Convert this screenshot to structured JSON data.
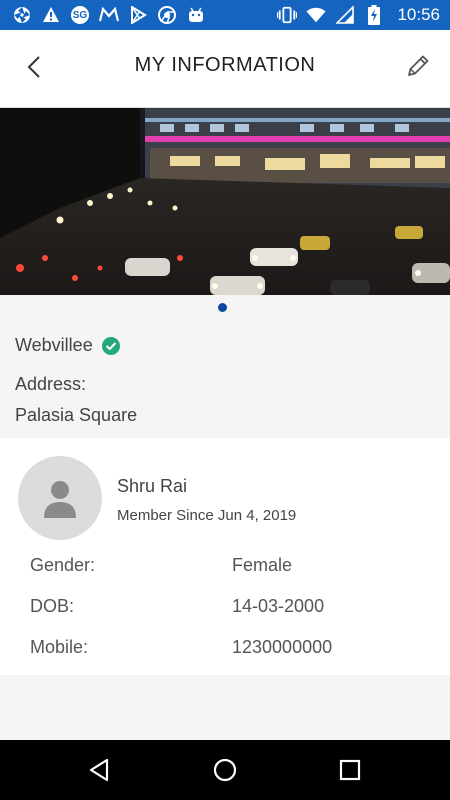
{
  "status_bar": {
    "time": "10:56",
    "left_icons": [
      "aperture-icon",
      "warning-icon",
      "sg-icon",
      "mail-icon",
      "play-store-icon",
      "chrome-icon",
      "android-icon"
    ],
    "sg_text": "SG",
    "right_icons": [
      "vibrate-icon",
      "wifi-icon",
      "signal-icon",
      "battery-charging-icon"
    ]
  },
  "app_bar": {
    "title": "MY INFORMATION"
  },
  "company": {
    "name": "Webvillee",
    "address_label": "Address:",
    "address_value": "Palasia Square"
  },
  "profile": {
    "name": "Shru Rai",
    "member_since": "Member Since Jun 4, 2019",
    "details": [
      {
        "label": "Gender:",
        "value": "Female"
      },
      {
        "label": "DOB:",
        "value": "14-03-2000"
      },
      {
        "label": "Mobile:",
        "value": "1230000000"
      }
    ]
  },
  "colors": {
    "status_bar": "#1565c0",
    "verified_badge": "#26a97a",
    "pager_dot": "#0d47a1"
  }
}
